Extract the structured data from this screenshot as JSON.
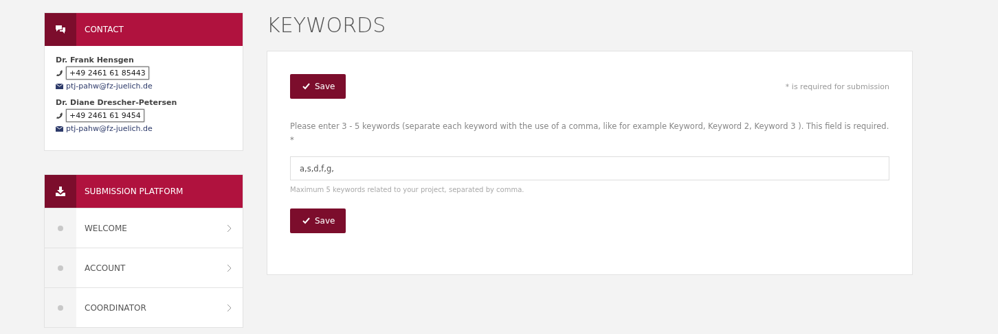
{
  "contact": {
    "title": "CONTACT",
    "people": [
      {
        "name": "Dr. Frank Hensgen",
        "phone": "+49 2461 61 85443",
        "email": "ptj-pahw@fz-juelich.de"
      },
      {
        "name": "Dr. Diane Drescher-Petersen",
        "phone": "+49 2461 61 9454",
        "email": "ptj-pahw@fz-juelich.de"
      }
    ]
  },
  "submission": {
    "title": "SUBMISSION PLATFORM",
    "items": [
      {
        "label": "WELCOME",
        "selected": false
      },
      {
        "label": "ACCOUNT",
        "selected": false
      },
      {
        "label": "COORDINATOR",
        "selected": false
      }
    ]
  },
  "page_title": "KEYWORDS",
  "form": {
    "save_top": "Save",
    "required_note": "* is required for submission",
    "instructions": "Please enter 3 - 5 keywords (separate each keyword with the use of a comma, like for example Keyword, Keyword 2, Keyword 3 ). This field is required. *",
    "value": "a,s,d,f,g,",
    "help": "Maximum 5 keywords related to your project, separated by comma.",
    "save_bottom": "Save"
  }
}
